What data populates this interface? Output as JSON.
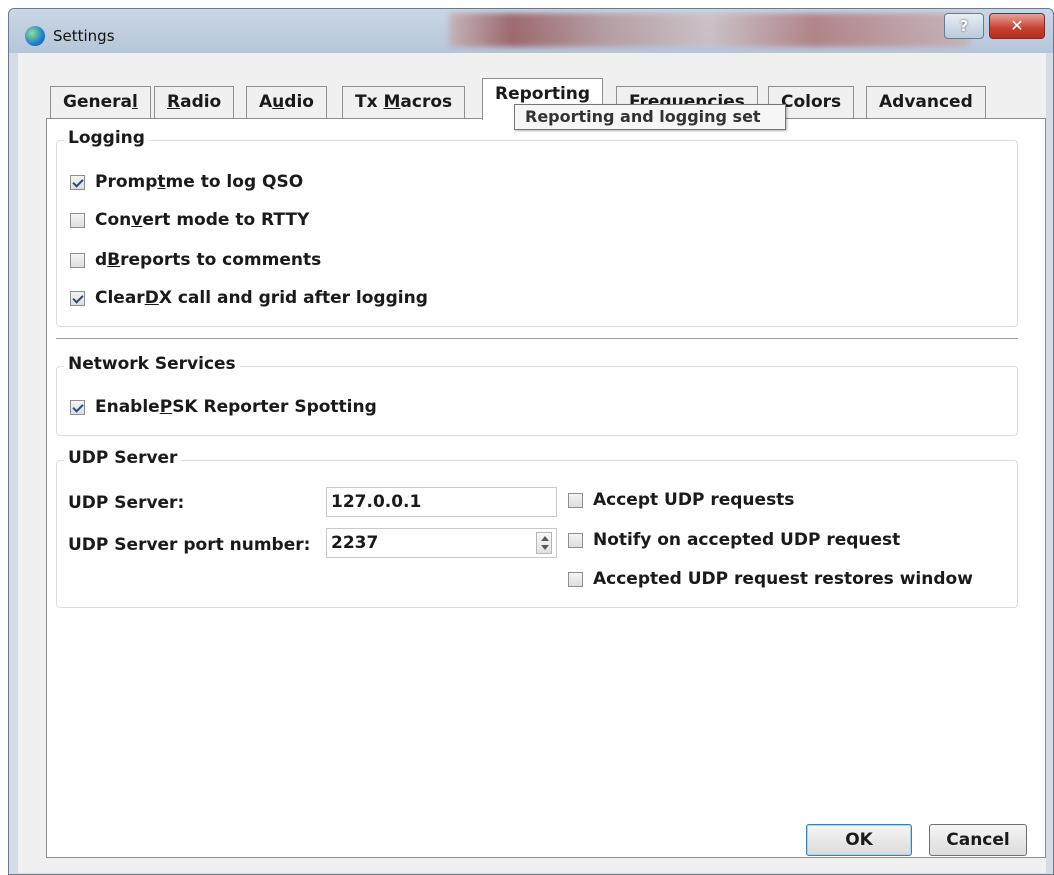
{
  "window": {
    "title": "Settings",
    "help_button": "?",
    "close_button": "✕"
  },
  "tabs": [
    {
      "label_pre": "Genera",
      "mnemonic": "l",
      "label_post": ""
    },
    {
      "label_pre": "",
      "mnemonic": "R",
      "label_post": "adio"
    },
    {
      "label_pre": "A",
      "mnemonic": "u",
      "label_post": "dio"
    },
    {
      "label_pre": "Tx ",
      "mnemonic": "M",
      "label_post": "acros"
    },
    {
      "label_pre": "Reporting",
      "mnemonic": "",
      "label_post": ""
    },
    {
      "label_pre": "Frequencies",
      "mnemonic": "",
      "label_post": ""
    },
    {
      "label_pre": "Colors",
      "mnemonic": "",
      "label_post": ""
    },
    {
      "label_pre": "Advanced",
      "mnemonic": "",
      "label_post": ""
    }
  ],
  "active_tab": "Reporting",
  "tooltip": "Reporting and logging set",
  "logging": {
    "title": "Logging",
    "options": [
      {
        "pre": "Promp",
        "mnemonic": "t",
        "post": " me to log QSO",
        "checked": true
      },
      {
        "pre": "Con",
        "mnemonic": "v",
        "post": "ert mode to RTTY",
        "checked": false
      },
      {
        "pre": "d",
        "mnemonic": "B",
        "post": " reports to comments",
        "checked": false
      },
      {
        "pre": "Clear ",
        "mnemonic": "D",
        "post": "X call and grid after logging",
        "checked": true
      }
    ]
  },
  "network": {
    "title": "Network Services",
    "psk": {
      "pre": "Enable ",
      "mnemonic": "P",
      "post": "SK Reporter Spotting",
      "checked": true
    }
  },
  "udp": {
    "title": "UDP Server",
    "server_label": "UDP Server:",
    "server_value": "127.0.0.1",
    "port_label": "UDP Server port number:",
    "port_value": "2237",
    "accept_requests": {
      "label": "Accept UDP requests",
      "checked": false
    },
    "notify_accepted": {
      "label": "Notify on accepted UDP request",
      "checked": false
    },
    "restores_window": {
      "label": "Accepted UDP request restores window",
      "checked": false
    }
  },
  "buttons": {
    "ok": "OK",
    "cancel": "Cancel"
  }
}
